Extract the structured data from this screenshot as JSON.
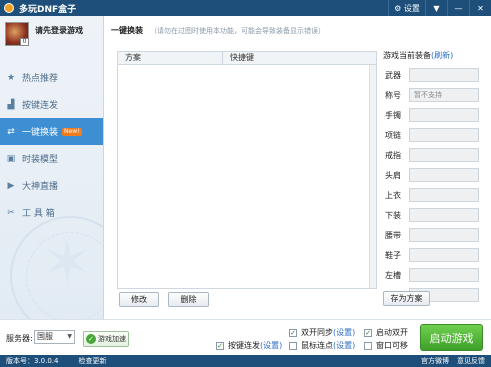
{
  "window": {
    "title": "多玩DNF盒子",
    "settings_label": "⚙ 设置",
    "menu_icon": "▼",
    "minimize_icon": "—",
    "close_icon": "✕"
  },
  "profile": {
    "login_text": "请先登录游戏",
    "avatar_badge": "0"
  },
  "nav": [
    {
      "label": "热点推荐",
      "icon": "★"
    },
    {
      "label": "按键连发",
      "icon": "▟"
    },
    {
      "label": "一键换装",
      "icon": "⇄",
      "badge": "New!"
    },
    {
      "label": "时装模型",
      "icon": "▣"
    },
    {
      "label": "大神直播",
      "icon": "▶"
    },
    {
      "label": "工 具 箱",
      "icon": "✂"
    }
  ],
  "main": {
    "title": "一键换装",
    "hint": "（请勿在过图时使用本功能，可能会导致装备显示错误）",
    "table": {
      "col_scheme": "方案",
      "col_hotkey": "快捷键"
    },
    "edit_label": "修改",
    "delete_label": "删除",
    "save_scheme_label": "存为方案",
    "equip_title": "游戏当前装备",
    "refresh_label": "(刷新)",
    "slots": [
      {
        "label": "武器",
        "value": ""
      },
      {
        "label": "称号",
        "value": "暂不支持"
      },
      {
        "label": "手镯",
        "value": ""
      },
      {
        "label": "项链",
        "value": ""
      },
      {
        "label": "戒指",
        "value": ""
      },
      {
        "label": "头肩",
        "value": ""
      },
      {
        "label": "上衣",
        "value": ""
      },
      {
        "label": "下装",
        "value": ""
      },
      {
        "label": "腰带",
        "value": ""
      },
      {
        "label": "鞋子",
        "value": ""
      },
      {
        "label": "左槽",
        "value": ""
      },
      {
        "label": "右槽",
        "value": ""
      }
    ]
  },
  "footer": {
    "server_label": "服务器:",
    "server_value": "国服",
    "accel_label": "游戏加速",
    "key_repeat_label": "按键连发",
    "key_repeat_checked": true,
    "dual_sync_label": "双开同步",
    "dual_sync_checked": true,
    "mouse_click_label": "鼠标连点",
    "mouse_click_checked": false,
    "auto_dual_label": "启动双开",
    "auto_dual_checked": true,
    "window_move_label": "窗口可移",
    "window_move_checked": false,
    "settings_link": "(设置)",
    "start_label": "启动游戏"
  },
  "status": {
    "version": "版本号：3.0.0.4",
    "check_update": "检查更新",
    "weibo": "官方微博",
    "feedback": "意见反馈"
  }
}
